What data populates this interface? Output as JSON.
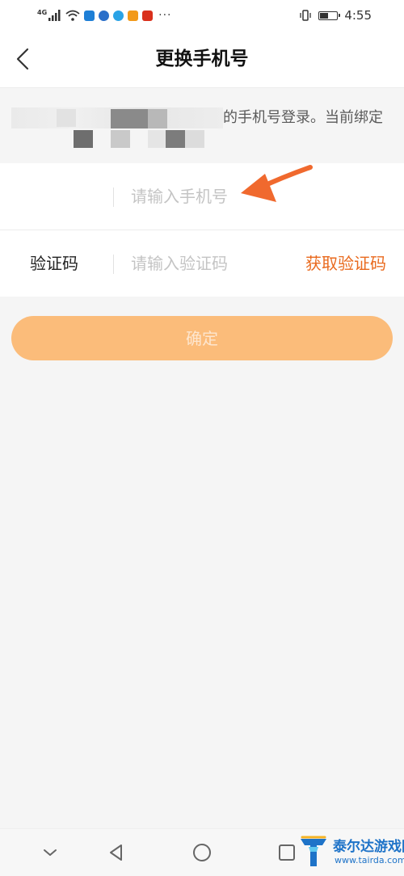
{
  "status_bar": {
    "network": "4G",
    "more": "···",
    "time": "4:55",
    "battery_level": 0.45
  },
  "header": {
    "title": "更换手机号"
  },
  "notice": {
    "visible_text": "的手机号登录。当前绑定"
  },
  "form": {
    "phone": {
      "placeholder": "请输入手机号",
      "value": ""
    },
    "code": {
      "label": "验证码",
      "placeholder": "请输入验证码",
      "value": "",
      "get_code_label": "获取验证码"
    }
  },
  "confirm_label": "确定",
  "watermark": {
    "title": "泰尔达游戏网",
    "url": "www.tairda.com"
  },
  "colors": {
    "accent": "#e96a1e",
    "confirm_bg": "#fbbc7a",
    "annotation_arrow": "#f0692e"
  }
}
